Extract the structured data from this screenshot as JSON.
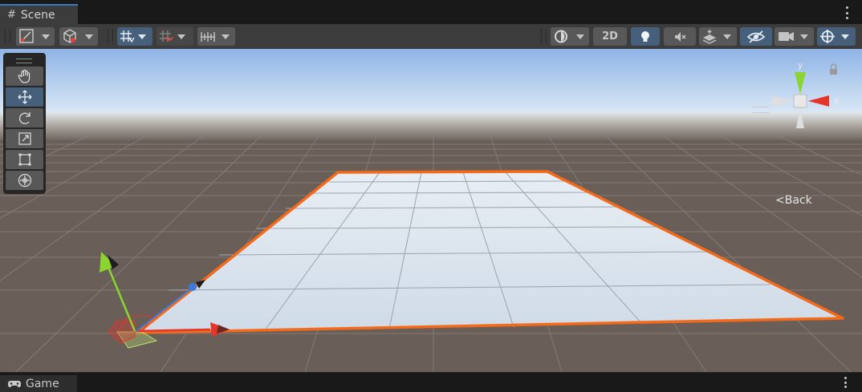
{
  "window": {
    "scene_tab": "Scene",
    "game_tab": "Game"
  },
  "toolbar": {
    "left_tools": [
      "draw-mode-dropdown",
      "shading-dropdown",
      "grid-snapping-toggle",
      "increment-snap-toggle",
      "ruler-dropdown"
    ],
    "view_2d_label": "2D",
    "right_tools": [
      "orientation-dropdown",
      "2d-toggle",
      "lighting-toggle",
      "audio-toggle",
      "effects-dropdown",
      "visibility-toggle",
      "camera-dropdown",
      "gizmos-dropdown"
    ]
  },
  "tools_overlay": {
    "items": [
      "hand-tool",
      "move-tool",
      "rotate-tool",
      "scale-tool",
      "rect-tool",
      "transform-tool"
    ],
    "active": "move-tool"
  },
  "orientation_gizmo": {
    "y_label": "y",
    "x_label": "x",
    "back_label": "Back"
  },
  "colors": {
    "accent_blue": "#3a79bb",
    "active_button": "#46607c",
    "selection_outline": "#f36a1a",
    "axis_x": "#e5342a",
    "axis_y": "#8ad530",
    "axis_z": "#3a7bdd",
    "ground": "#695f58",
    "plane": "#d4dde6"
  }
}
